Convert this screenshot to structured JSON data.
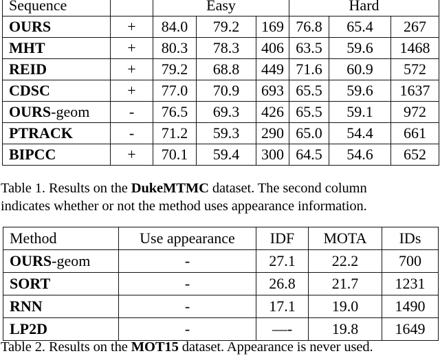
{
  "document": {
    "type": "paper-tables",
    "tables": [
      {
        "id": "table-1",
        "header_groups": [
          {
            "label": "Sequence",
            "span": 1
          },
          {
            "label": "",
            "span": 1
          },
          {
            "label": "Easy",
            "span": 3
          },
          {
            "label": "Hard",
            "span": 3
          }
        ],
        "rows": [
          {
            "method": "OURS",
            "method_suffix": "",
            "bold_name": true,
            "appearance": "+",
            "easy_idf": "84.0",
            "easy_mota": "79.2",
            "easy_ids": "169",
            "hard_idf": "76.8",
            "hard_mota": "65.4",
            "hard_ids": "267",
            "bold_values": true
          },
          {
            "method": "MHT",
            "method_suffix": "",
            "bold_name": true,
            "appearance": "+",
            "easy_idf": "80.3",
            "easy_mota": "78.3",
            "easy_ids": "406",
            "hard_idf": "63.5",
            "hard_mota": "59.6",
            "hard_ids": "1468",
            "bold_values": false
          },
          {
            "method": "REID",
            "method_suffix": "",
            "bold_name": true,
            "appearance": "+",
            "easy_idf": "79.2",
            "easy_mota": "68.8",
            "easy_ids": "449",
            "hard_idf": "71.6",
            "hard_mota": "60.9",
            "hard_ids": "572",
            "bold_values": false
          },
          {
            "method": "CDSC",
            "method_suffix": "",
            "bold_name": true,
            "appearance": "+",
            "easy_idf": "77.0",
            "easy_mota": "70.9",
            "easy_ids": "693",
            "hard_idf": "65.5",
            "hard_mota": "59.6",
            "hard_ids": "1637",
            "bold_values": false
          },
          {
            "method": "OURS",
            "method_suffix": "-geom",
            "bold_name": true,
            "appearance": "-",
            "easy_idf": "76.5",
            "easy_mota": "69.3",
            "easy_ids": "426",
            "hard_idf": "65.5",
            "hard_mota": "59.1",
            "hard_ids": "972",
            "bold_values": false
          },
          {
            "method": "PTRACK",
            "method_suffix": "",
            "bold_name": true,
            "appearance": "-",
            "easy_idf": "71.2",
            "easy_mota": "59.3",
            "easy_ids": "290",
            "hard_idf": "65.0",
            "hard_mota": "54.4",
            "hard_ids": "661",
            "bold_values": false
          },
          {
            "method": "BIPCC",
            "method_suffix": "",
            "bold_name": true,
            "appearance": "+",
            "easy_idf": "70.1",
            "easy_mota": "59.4",
            "easy_ids": "300",
            "hard_idf": "64.5",
            "hard_mota": "54.6",
            "hard_ids": "652",
            "bold_values": false
          }
        ],
        "caption": {
          "line1_a": "Table 1. Results on the ",
          "line1_bold": "DukeMTMC",
          "line1_b": " dataset. The second column",
          "line2": "indicates whether or not the method uses appearance information."
        }
      },
      {
        "id": "table-2",
        "headers": [
          "Method",
          "Use appearance",
          "IDF",
          "MOTA",
          "IDs"
        ],
        "headers_bold": [
          false,
          false,
          true,
          true,
          false
        ],
        "rows": [
          {
            "method": "OURS",
            "method_suffix": "-geom",
            "appearance": "-",
            "idf": "27.1",
            "mota": "22.2",
            "ids": "700",
            "bold_values": true
          },
          {
            "method": "SORT",
            "method_suffix": "",
            "appearance": "-",
            "idf": "26.8",
            "mota": "21.7",
            "ids": "1231",
            "bold_values": false
          },
          {
            "method": "RNN",
            "method_suffix": "",
            "appearance": "-",
            "idf": "17.1",
            "mota": "19.0",
            "ids": "1490",
            "bold_values": false
          },
          {
            "method": "LP2D",
            "method_suffix": "",
            "appearance": "-",
            "idf": "—-",
            "mota": "19.8",
            "ids": "1649",
            "bold_values": false
          }
        ],
        "caption": {
          "line1_a": "Table 2. Results on the ",
          "line1_bold": "MOT15",
          "line1_b": " dataset.  Appearance is never used."
        }
      }
    ]
  }
}
